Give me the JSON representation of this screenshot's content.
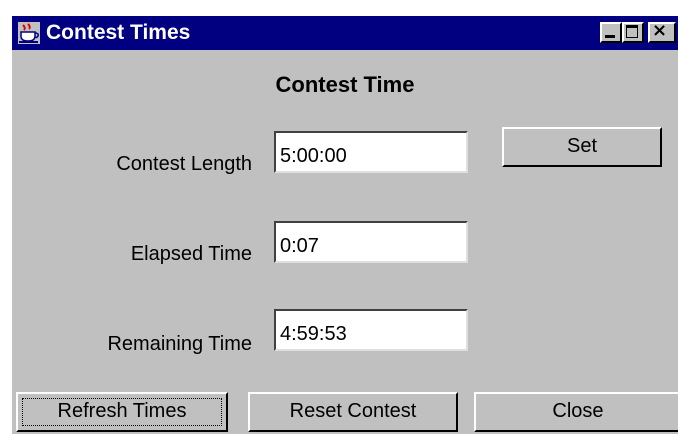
{
  "window": {
    "title": "Contest Times",
    "icon": "java-coffee-cup-icon",
    "controls": {
      "minimize": "minimize-icon",
      "maximize": "maximize-icon",
      "close_glyph": "×"
    }
  },
  "heading": "Contest Time",
  "fields": {
    "contest_length": {
      "label": "Contest Length",
      "value": "5:00:00"
    },
    "elapsed_time": {
      "label": "Elapsed Time",
      "value": "0:07"
    },
    "remaining_time": {
      "label": "Remaining Time",
      "value": "4:59:53"
    }
  },
  "buttons": {
    "set": "Set",
    "refresh": "Refresh Times",
    "reset": "Reset Contest",
    "close": "Close"
  },
  "colors": {
    "titlebar": "#000080",
    "face": "#c0c0c0"
  }
}
